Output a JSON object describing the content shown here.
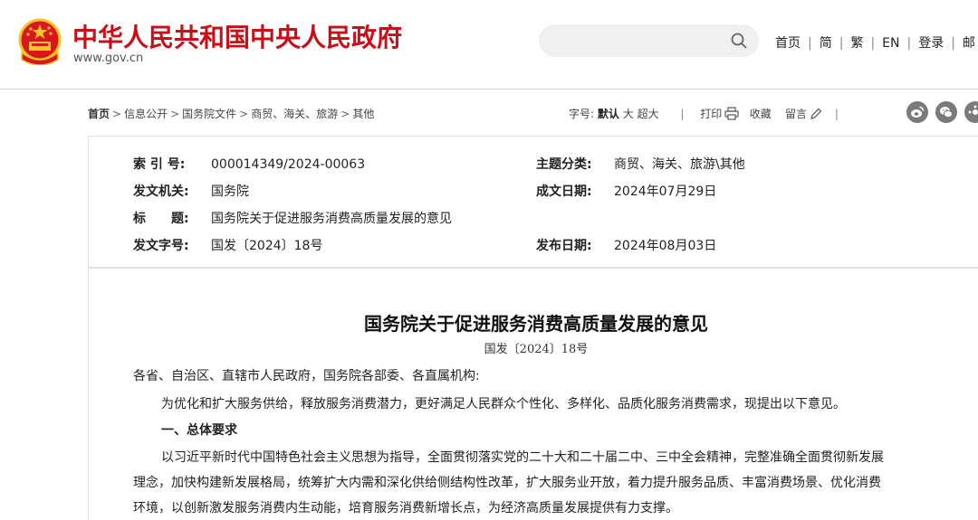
{
  "header": {
    "site_title": "中华人民共和国中央人民政府",
    "site_url": "www.gov.cn",
    "search_placeholder": "",
    "nav": [
      "首页",
      "简",
      "繁",
      "EN",
      "登录",
      "邮"
    ]
  },
  "breadcrumb": [
    "首页",
    "信息公开",
    "国务院文件",
    "商贸、海关、旅游",
    "其他"
  ],
  "tools": {
    "font_label": "字号:",
    "font_default": "默认",
    "font_large": "大",
    "font_xlarge": "超大",
    "print": "打印",
    "favorite": "收藏",
    "comment": "留言"
  },
  "meta": {
    "index_no_label": "索 引 号:",
    "index_no": "000014349/2024-00063",
    "topic_label": "主题分类:",
    "topic": "商贸、海关、旅游\\其他",
    "issuer_label": "发文机关:",
    "issuer": "国务院",
    "created_label": "成文日期:",
    "created": "2024年07月29日",
    "title_label": "标　　题:",
    "title": "国务院关于促进服务消费高质量发展的意见",
    "doc_no_label": "发文字号:",
    "doc_no": "国发〔2024〕18号",
    "published_label": "发布日期:",
    "published": "2024年08月03日"
  },
  "article": {
    "title": "国务院关于促进服务消费高质量发展的意见",
    "doc_no": "国发〔2024〕18号",
    "salutation": "各省、自治区、直辖市人民政府，国务院各部委、各直属机构:",
    "intro": "为优化和扩大服务供给，释放服务消费潜力，更好满足人民群众个性化、多样化、品质化服务消费需求，现提出以下意见。",
    "section1_heading": "一、总体要求",
    "section1_line1": "以习近平新时代中国特色社会主义思想为指导，全面贯彻落实党的二十大和二十届二中、三中全会精神，完整准确全面贯彻新发展",
    "section1_line2": "理念，加快构建新发展格局，统筹扩大内需和深化供给侧结构性改革，扩大服务业开放，着力提升服务品质、丰富消费场景、优化消费",
    "section1_line3": "环境，以创新激发服务消费内生动能，培育服务消费新增长点，为经济高质量发展提供有力支撑。"
  },
  "colors": {
    "brand_red": "#c8101a",
    "emblem_red": "#d7191f",
    "emblem_gold": "#f3c623",
    "share_grey": "#7a7a7a"
  },
  "icons": [
    "national-emblem-icon",
    "search-icon",
    "printer-icon",
    "pencil-icon",
    "weibo-icon",
    "wechat-icon",
    "share-more-icon"
  ]
}
